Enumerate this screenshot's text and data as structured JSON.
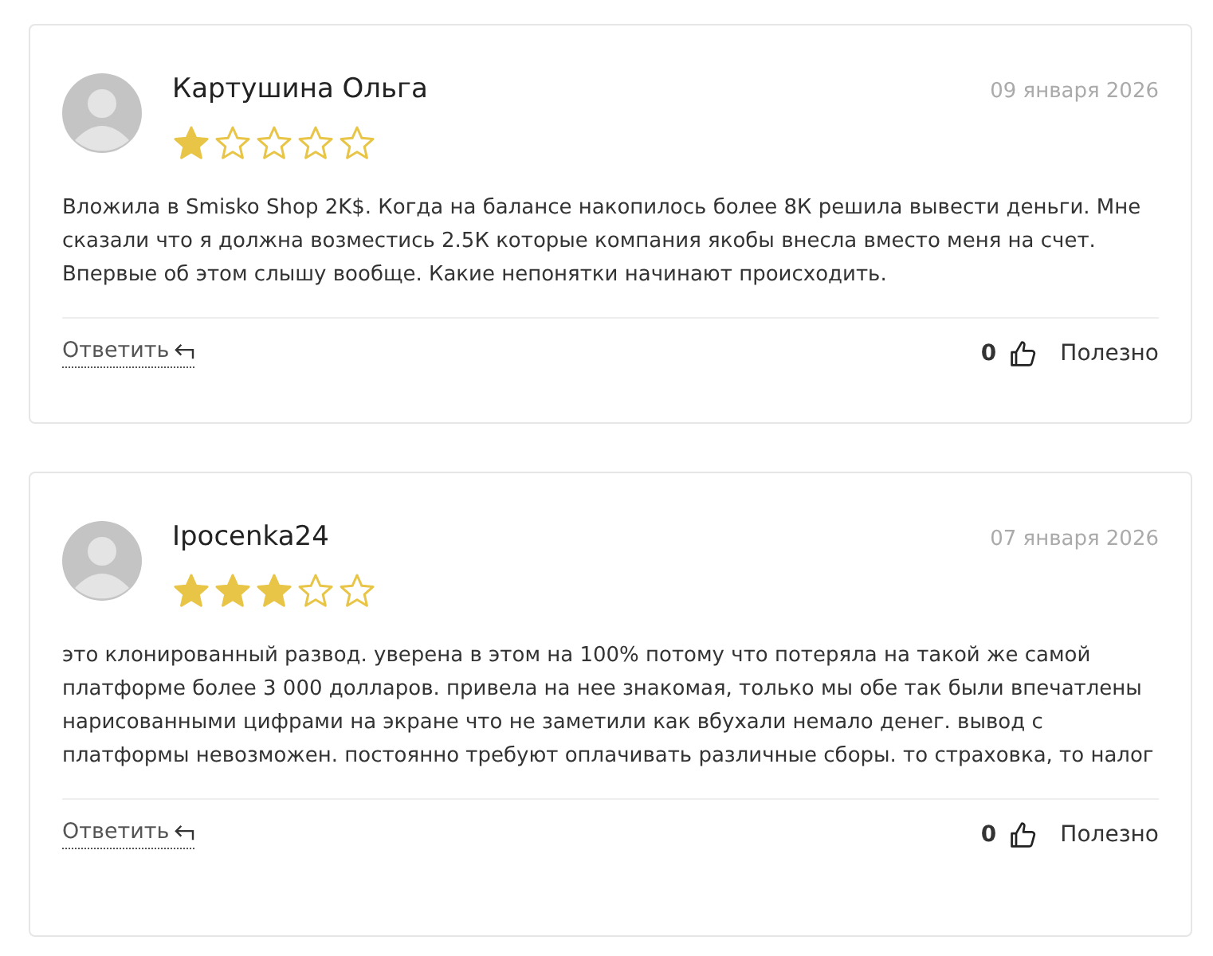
{
  "reviews": [
    {
      "author": "Картушина Ольга",
      "date": "09 января 2026",
      "stars": 1,
      "text": "Вложила в Smisko Shop 2K$. Когда на балансе накопилось более 8К решила вывести деньги. Мне сказали что я должна возместись 2.5К которые компания якобы внесла вместо меня на счет. Впервые об этом слышу вообще. Какие непонятки начинают происходить.",
      "reply": "Ответить",
      "likes": "0",
      "helpful": "Полезно"
    },
    {
      "author": "Ipocenka24",
      "date": "07 января 2026",
      "stars": 3,
      "text": "это клонированный развод. уверена в этом на 100% потому что потеряла на такой же самой платформе более 3 000 долларов. привела на нее знакомая, только мы обе так были впечатлены нарисованными цифрами на экране что не заметили как вбухали немало денег. вывод с платформы невозможен. постоянно требуют оплачивать различные сборы. то страховка, то налог",
      "reply": "Ответить",
      "likes": "0",
      "helpful": "Полезно"
    }
  ]
}
